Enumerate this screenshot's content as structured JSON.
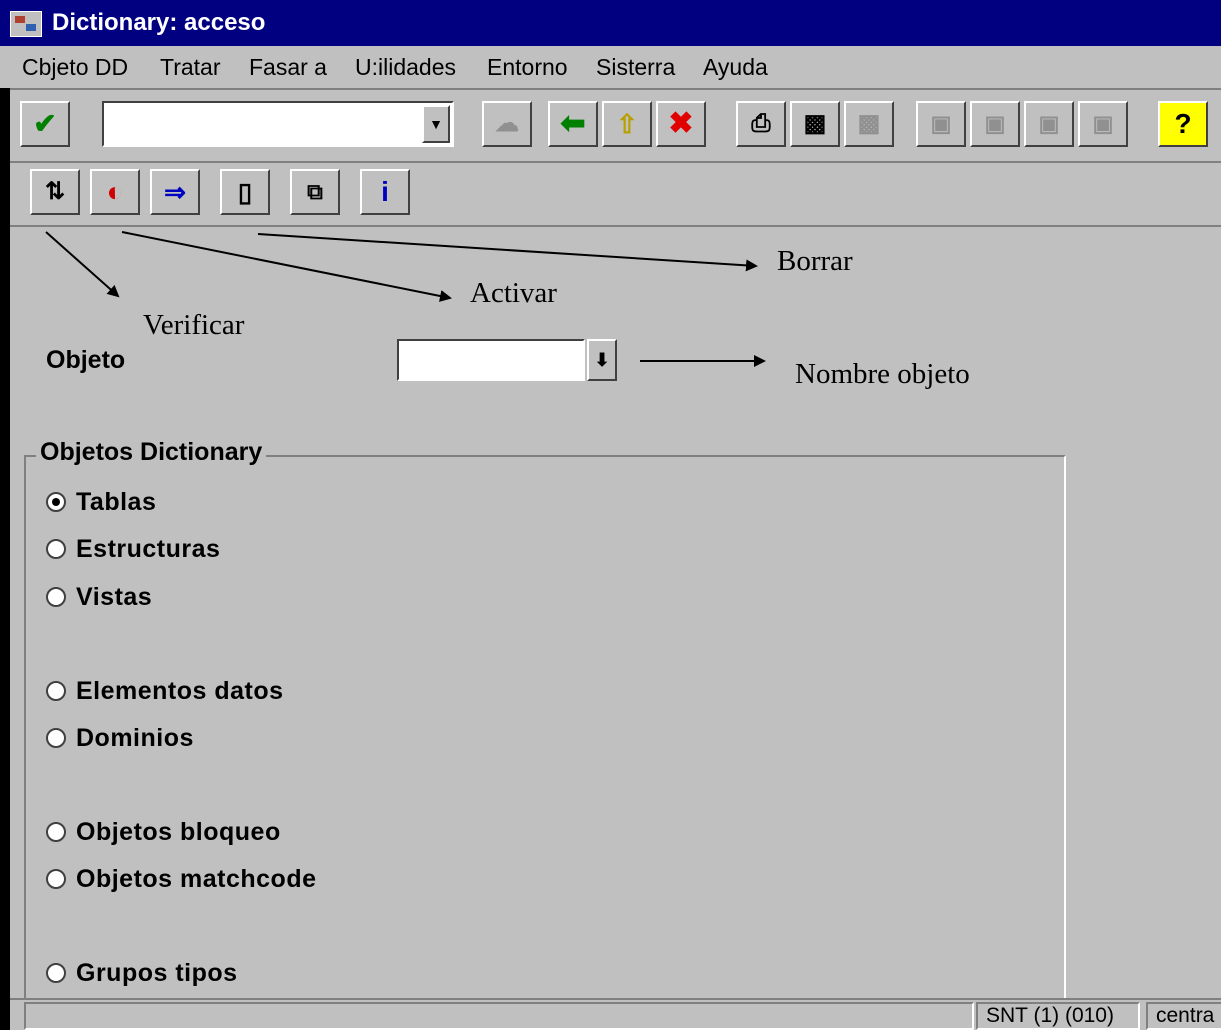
{
  "window": {
    "title": "Dictionary: acceso"
  },
  "menu": [
    "Cbjeto DD",
    "Tratar",
    "Fasar a",
    "U:ilidades",
    "Entorno",
    "Sisterra",
    "Ayuda"
  ],
  "toolbar": {
    "command_field_value": "",
    "icons": [
      "check-icon",
      "save-icon",
      "back-icon",
      "exit-icon",
      "cancel-icon",
      "print-icon",
      "find-icon",
      "find-next-icon",
      "first-page-icon",
      "previous-page-icon",
      "next-page-icon",
      "last-page-icon",
      "help-icon"
    ]
  },
  "app_toolbar": {
    "icons": [
      "check-object-icon",
      "activate-icon",
      "where-used-icon",
      "delete-icon",
      "copy-icon",
      "info-icon"
    ]
  },
  "annotations": {
    "borrar": "Borrar",
    "activar": "Activar",
    "verificar": "Verificar",
    "nombre_objeto": "Nombre objeto"
  },
  "form": {
    "objeto_label": "Objeto",
    "objeto_value": ""
  },
  "group": {
    "title": "Objetos Dictionary",
    "options": [
      {
        "label": "Tablas",
        "checked": true
      },
      {
        "label": "Estructuras",
        "checked": false
      },
      {
        "label": "Vistas",
        "checked": false
      },
      {
        "label": "Elementos datos",
        "checked": false
      },
      {
        "label": "Dominios",
        "checked": false
      },
      {
        "label": "Objetos bloqueo",
        "checked": false
      },
      {
        "label": "Objetos matchcode",
        "checked": false
      },
      {
        "label": "Grupos tipos",
        "checked": false
      }
    ]
  },
  "status": {
    "system": "SNT (1) (010)",
    "server": "centra"
  }
}
